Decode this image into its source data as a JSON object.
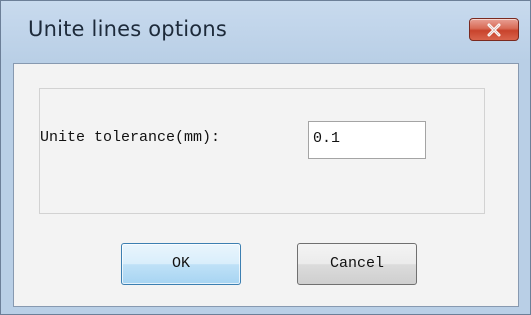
{
  "window": {
    "title": "Unite lines options",
    "close_icon": "close-icon"
  },
  "form": {
    "tolerance_label": "Unite tolerance(mm):",
    "tolerance_value": "0.1"
  },
  "buttons": {
    "ok_label": "OK",
    "cancel_label": "Cancel"
  },
  "colors": {
    "titlebar": "#b9cfe6",
    "close_button": "#c8432c",
    "client_background": "#f3f3f3",
    "default_button_border": "#3c7fb1"
  }
}
